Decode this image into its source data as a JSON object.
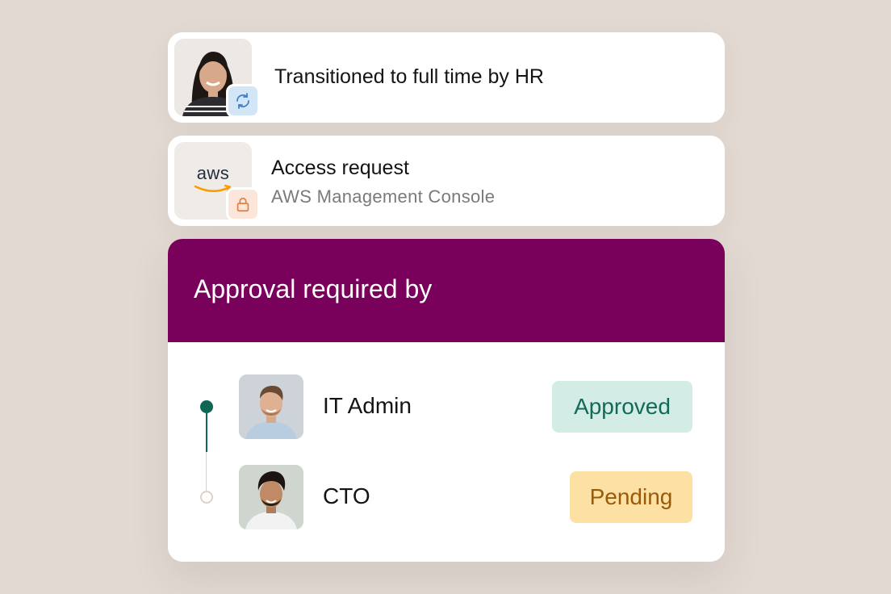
{
  "hr_event": {
    "title": "Transitioned to full time by HR",
    "badge_icon": "sync-icon"
  },
  "access_request": {
    "title": "Access request",
    "subtitle": "AWS Management Console",
    "logo_text": "aws",
    "badge_icon": "lock-icon"
  },
  "approval": {
    "title": "Approval required by",
    "header_color": "#79005b",
    "approvers": [
      {
        "role": "IT Admin",
        "status": "Approved",
        "status_color": "#126a59",
        "status_bg": "#d3ede6"
      },
      {
        "role": "CTO",
        "status": "Pending",
        "status_color": "#9a5a0a",
        "status_bg": "#fde0a3"
      }
    ]
  }
}
